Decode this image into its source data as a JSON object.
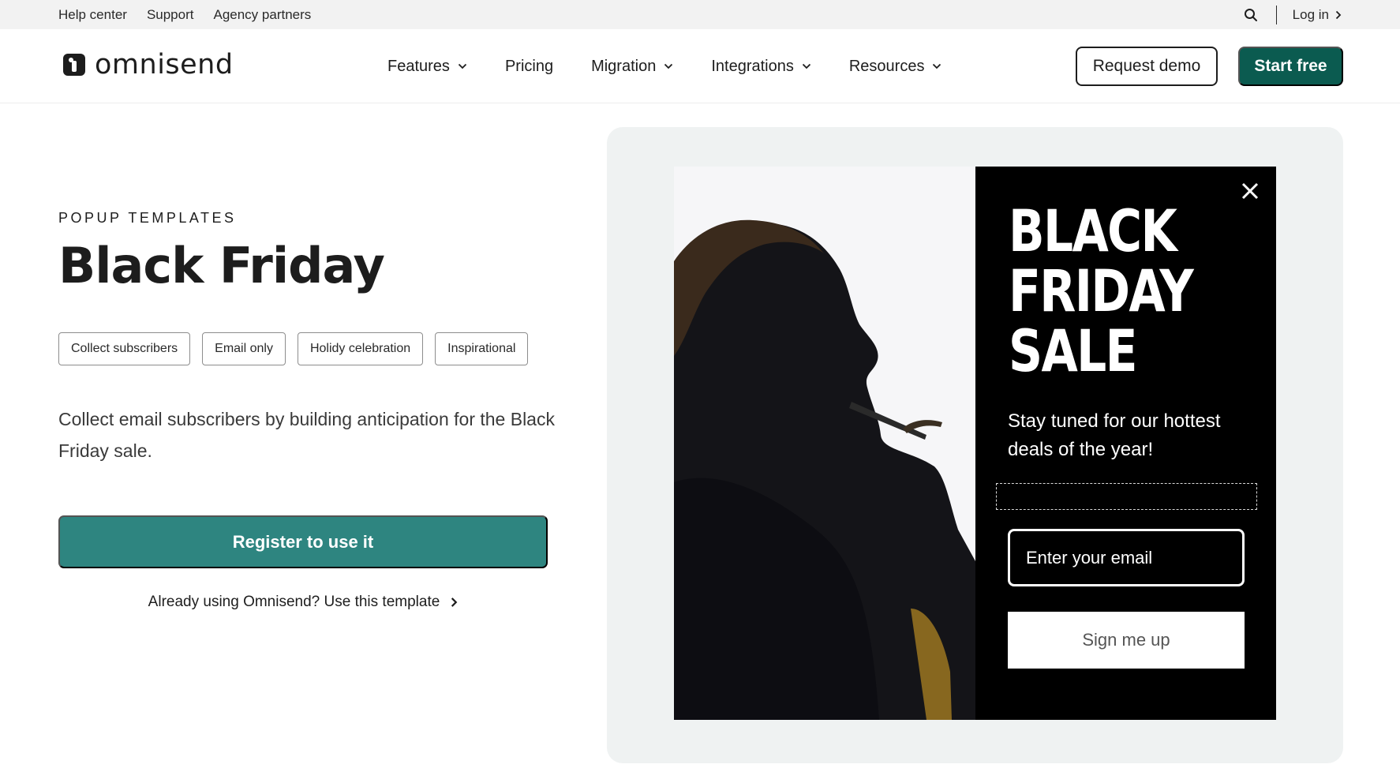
{
  "utility_bar": {
    "links": [
      "Help center",
      "Support",
      "Agency partners"
    ],
    "login_label": "Log in"
  },
  "nav": {
    "logo_text": "omnisend",
    "items": [
      {
        "label": "Features",
        "has_dropdown": true
      },
      {
        "label": "Pricing",
        "has_dropdown": false
      },
      {
        "label": "Migration",
        "has_dropdown": true
      },
      {
        "label": "Integrations",
        "has_dropdown": true
      },
      {
        "label": "Resources",
        "has_dropdown": true
      }
    ],
    "request_demo_label": "Request demo",
    "start_free_label": "Start free"
  },
  "hero": {
    "eyebrow": "POPUP TEMPLATES",
    "title": "Black Friday",
    "tags": [
      "Collect subscribers",
      "Email only",
      "Holidy celebration",
      "Inspirational"
    ],
    "description": "Collect email subscribers by building anticipation for the Black Friday sale.",
    "register_label": "Register to use it",
    "already_label": "Already using Omnisend? Use this template"
  },
  "popup_preview": {
    "headline": "BLACK\nFRIDAY\nSALE",
    "subtext": "Stay tuned for our hottest deals of the year!",
    "email_placeholder": "Enter your email",
    "signup_label": "Sign me up"
  },
  "colors": {
    "brand_dark_green": "#0b5b50",
    "register_teal": "#2e8580",
    "utility_bg": "#f2f2f2",
    "preview_bg": "#eff2f2"
  },
  "icons": [
    "search-icon",
    "chevron-right-icon",
    "chevron-down-icon",
    "close-icon",
    "omnisend-logo"
  ]
}
